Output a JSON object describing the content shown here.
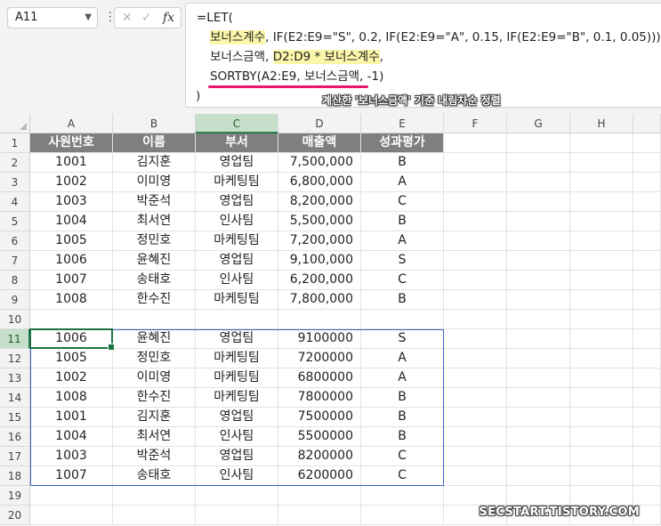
{
  "namebox": {
    "value": "A11"
  },
  "formula_bar": {
    "fx_label": "fx",
    "lines": {
      "l1": "=LET(",
      "l2_hl": "보너스계수",
      "l2_rest": ", IF(E2:E9=\"S\", 0.2, IF(E2:E9=\"A\", 0.15, IF(E2:E9=\"B\", 0.1, 0.05))),",
      "l3_a": "보너스금액, ",
      "l3_hl": "D2:D9 * 보너스계수",
      "l3_b": ",",
      "l4": "SORTBY(A2:E9, 보너스금액, -1)",
      "l5": ")"
    },
    "annotation": "계산한 '보너스금액' 기준 내림차순 정렬"
  },
  "columns": [
    "A",
    "B",
    "C",
    "D",
    "E",
    "F",
    "G",
    "H"
  ],
  "selected_column": "C",
  "rows": [
    "1",
    "2",
    "3",
    "4",
    "5",
    "6",
    "7",
    "8",
    "9",
    "10",
    "11",
    "12",
    "13",
    "14",
    "15",
    "16",
    "17",
    "18",
    "19",
    "20"
  ],
  "selected_row": "11",
  "table_header": [
    "사원번호",
    "이름",
    "부서",
    "매출액",
    "성과평가"
  ],
  "source_rows": [
    [
      "1001",
      "김지훈",
      "영업팀",
      "7,500,000",
      "B"
    ],
    [
      "1002",
      "이미영",
      "마케팅팀",
      "6,800,000",
      "A"
    ],
    [
      "1003",
      "박준석",
      "영업팀",
      "8,200,000",
      "C"
    ],
    [
      "1004",
      "최서연",
      "인사팀",
      "5,500,000",
      "B"
    ],
    [
      "1005",
      "정민호",
      "마케팅팀",
      "7,200,000",
      "A"
    ],
    [
      "1006",
      "윤혜진",
      "영업팀",
      "9,100,000",
      "S"
    ],
    [
      "1007",
      "송태호",
      "인사팀",
      "6,200,000",
      "C"
    ],
    [
      "1008",
      "한수진",
      "마케팅팀",
      "7,800,000",
      "B"
    ]
  ],
  "result_rows": [
    [
      "1006",
      "윤혜진",
      "영업팀",
      "9100000",
      "S"
    ],
    [
      "1005",
      "정민호",
      "마케팅팀",
      "7200000",
      "A"
    ],
    [
      "1002",
      "이미영",
      "마케팅팀",
      "6800000",
      "A"
    ],
    [
      "1008",
      "한수진",
      "마케팅팀",
      "7800000",
      "B"
    ],
    [
      "1001",
      "김지훈",
      "영업팀",
      "7500000",
      "B"
    ],
    [
      "1004",
      "최서연",
      "인사팀",
      "5500000",
      "B"
    ],
    [
      "1003",
      "박준석",
      "영업팀",
      "8200000",
      "C"
    ],
    [
      "1007",
      "송태호",
      "인사팀",
      "6200000",
      "C"
    ]
  ],
  "watermark": "SECSTART.TISTORY.COM",
  "colors": {
    "header_fill": "#7f7f7f",
    "selection": "#1f7244",
    "spill_border": "#3b64c8",
    "highlight": "#fbf6a9",
    "underline": "#e8176b"
  }
}
